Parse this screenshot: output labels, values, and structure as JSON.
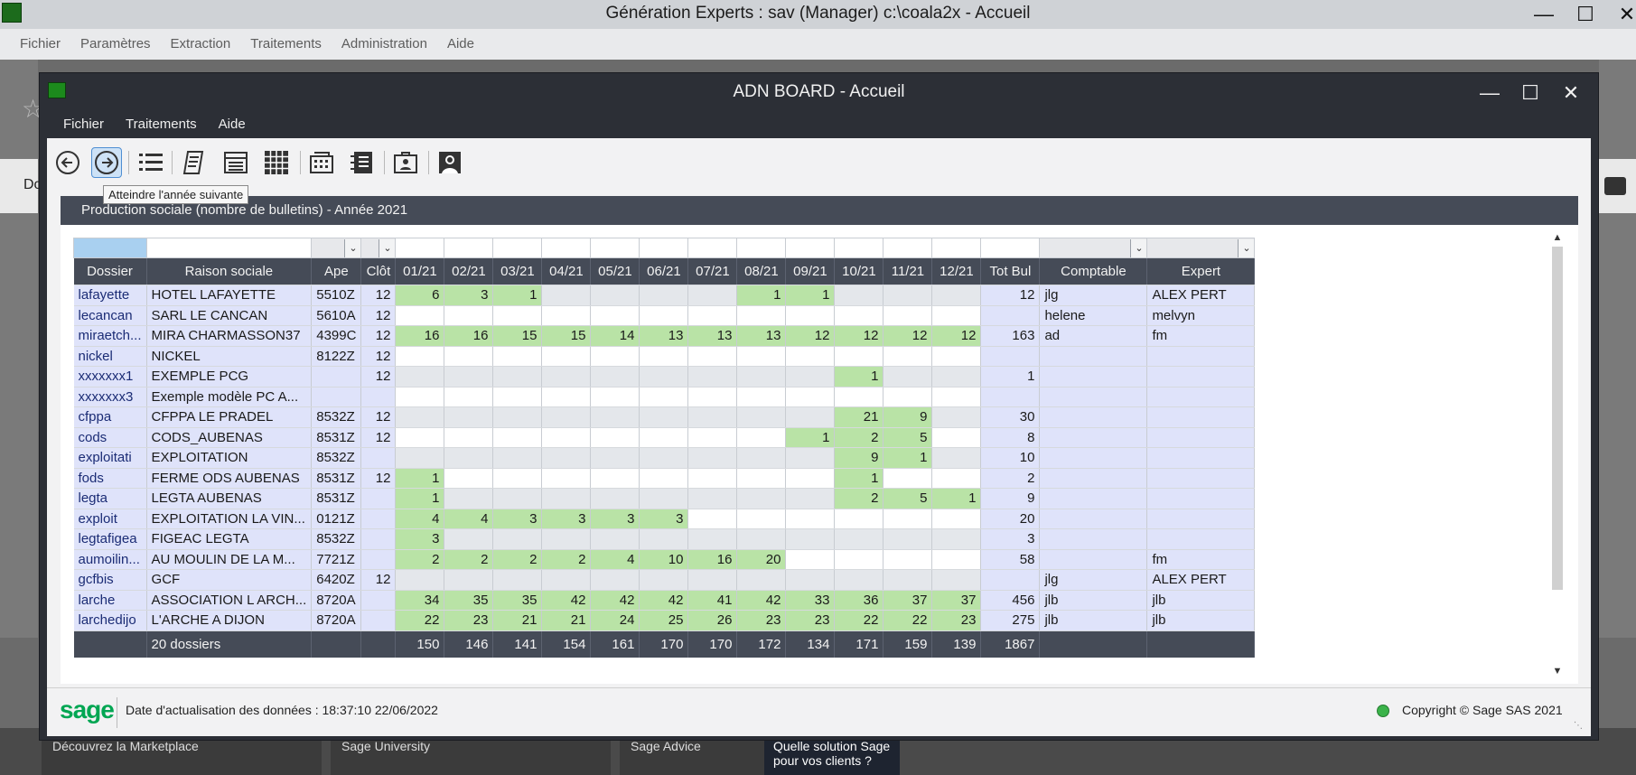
{
  "outer": {
    "title": "Génération Experts : sav (Manager) c:\\coala2x - Accueil",
    "menu": [
      "Fichier",
      "Paramètres",
      "Extraction",
      "Traitements",
      "Administration",
      "Aide"
    ],
    "left_tab_text": "Do",
    "bottom_tiles": [
      "Découvrez la Marketplace",
      "Sage University",
      "Sage Advice",
      "Quelle solution Sage pour vos clients ?"
    ]
  },
  "inner": {
    "title": "ADN BOARD - Accueil",
    "menu": [
      "Fichier",
      "Traitements",
      "Aide"
    ],
    "tooltip": "Atteindre l'année suivante",
    "panel_title": "Production sociale (nombre de bulletins) - Année 2021",
    "status_date": "Date d'actualisation des données : 18:37:10 22/06/2022",
    "copyright": "Copyright © Sage SAS 2021",
    "logo": "sage"
  },
  "columns": [
    "Dossier",
    "Raison sociale",
    "Ape",
    "Clôt",
    "01/21",
    "02/21",
    "03/21",
    "04/21",
    "05/21",
    "06/21",
    "07/21",
    "08/21",
    "09/21",
    "10/21",
    "11/21",
    "12/21",
    "Tot Bul",
    "Comptable",
    "Expert"
  ],
  "rows": [
    {
      "dossier": "lafayette",
      "raison": "HOTEL LAFAYETTE",
      "ape": "5510Z",
      "clot": "12",
      "m": [
        "6",
        "3",
        "1",
        "",
        "",
        "",
        "",
        "1",
        "1",
        "",
        "",
        ""
      ],
      "tot": "12",
      "comptable": "jlg",
      "expert": "ALEX PERT"
    },
    {
      "dossier": "lecancan",
      "raison": "SARL LE CANCAN",
      "ape": "5610A",
      "clot": "12",
      "m": [
        "",
        "",
        "",
        "",
        "",
        "",
        "",
        "",
        "",
        "",
        "",
        ""
      ],
      "tot": "",
      "comptable": "helene",
      "expert": "melvyn"
    },
    {
      "dossier": "miraetch...",
      "raison": "MIRA  CHARMASSON37",
      "ape": "4399C",
      "clot": "12",
      "m": [
        "16",
        "16",
        "15",
        "15",
        "14",
        "13",
        "13",
        "13",
        "12",
        "12",
        "12",
        "12"
      ],
      "tot": "163",
      "comptable": "ad",
      "expert": "fm"
    },
    {
      "dossier": "nickel",
      "raison": "NICKEL",
      "ape": "8122Z",
      "clot": "12",
      "m": [
        "",
        "",
        "",
        "",
        "",
        "",
        "",
        "",
        "",
        "",
        "",
        ""
      ],
      "tot": "",
      "comptable": "",
      "expert": ""
    },
    {
      "dossier": "xxxxxxx1",
      "raison": "EXEMPLE PCG",
      "ape": "",
      "clot": "12",
      "m": [
        "",
        "",
        "",
        "",
        "",
        "",
        "",
        "",
        "",
        "1",
        "",
        ""
      ],
      "tot": "1",
      "comptable": "",
      "expert": ""
    },
    {
      "dossier": "xxxxxxx3",
      "raison": "Exemple modèle PC A...",
      "ape": "",
      "clot": "",
      "m": [
        "",
        "",
        "",
        "",
        "",
        "",
        "",
        "",
        "",
        "",
        "",
        ""
      ],
      "tot": "",
      "comptable": "",
      "expert": ""
    },
    {
      "dossier": "cfppa",
      "raison": "CFPPA LE PRADEL",
      "ape": "8532Z",
      "clot": "12",
      "m": [
        "",
        "",
        "",
        "",
        "",
        "",
        "",
        "",
        "",
        "21",
        "9",
        ""
      ],
      "tot": "30",
      "comptable": "",
      "expert": ""
    },
    {
      "dossier": "cods",
      "raison": "CODS_AUBENAS",
      "ape": "8531Z",
      "clot": "12",
      "m": [
        "",
        "",
        "",
        "",
        "",
        "",
        "",
        "",
        "1",
        "2",
        "5",
        ""
      ],
      "tot": "8",
      "comptable": "",
      "expert": ""
    },
    {
      "dossier": "exploitati",
      "raison": "EXPLOITATION",
      "ape": "8532Z",
      "clot": "",
      "m": [
        "",
        "",
        "",
        "",
        "",
        "",
        "",
        "",
        "",
        "9",
        "1",
        ""
      ],
      "tot": "10",
      "comptable": "",
      "expert": ""
    },
    {
      "dossier": "fods",
      "raison": "FERME ODS AUBENAS",
      "ape": "8531Z",
      "clot": "12",
      "m": [
        "1",
        "",
        "",
        "",
        "",
        "",
        "",
        "",
        "",
        "1",
        "",
        ""
      ],
      "tot": "2",
      "comptable": "",
      "expert": ""
    },
    {
      "dossier": "legta",
      "raison": "LEGTA AUBENAS",
      "ape": "8531Z",
      "clot": "",
      "m": [
        "1",
        "",
        "",
        "",
        "",
        "",
        "",
        "",
        "",
        "2",
        "5",
        "1"
      ],
      "tot": "9",
      "comptable": "",
      "expert": ""
    },
    {
      "dossier": "exploit",
      "raison": "EXPLOITATION LA VIN...",
      "ape": "0121Z",
      "clot": "",
      "m": [
        "4",
        "4",
        "3",
        "3",
        "3",
        "3",
        "",
        "",
        "",
        "",
        "",
        ""
      ],
      "tot": "20",
      "comptable": "",
      "expert": ""
    },
    {
      "dossier": "legtafigea",
      "raison": "FIGEAC LEGTA",
      "ape": "8532Z",
      "clot": "",
      "m": [
        "3",
        "",
        "",
        "",
        "",
        "",
        "",
        "",
        "",
        "",
        "",
        ""
      ],
      "tot": "3",
      "comptable": "",
      "expert": ""
    },
    {
      "dossier": "aumoilin...",
      "raison": "AU MOULIN DE LA M...",
      "ape": "7721Z",
      "clot": "",
      "m": [
        "2",
        "2",
        "2",
        "2",
        "4",
        "10",
        "16",
        "20",
        "",
        "",
        "",
        ""
      ],
      "tot": "58",
      "comptable": "",
      "expert": "fm"
    },
    {
      "dossier": "gcfbis",
      "raison": "GCF",
      "ape": "6420Z",
      "clot": "12",
      "m": [
        "",
        "",
        "",
        "",
        "",
        "",
        "",
        "",
        "",
        "",
        "",
        ""
      ],
      "tot": "",
      "comptable": "jlg",
      "expert": "ALEX PERT"
    },
    {
      "dossier": "larche",
      "raison": "ASSOCIATION L ARCH...",
      "ape": "8720A",
      "clot": "",
      "m": [
        "34",
        "35",
        "35",
        "42",
        "42",
        "42",
        "41",
        "42",
        "33",
        "36",
        "37",
        "37"
      ],
      "tot": "456",
      "comptable": "jlb",
      "expert": "jlb"
    },
    {
      "dossier": "larchedijo",
      "raison": "L'ARCHE A DIJON",
      "ape": "8720A",
      "clot": "",
      "m": [
        "22",
        "23",
        "21",
        "21",
        "24",
        "25",
        "26",
        "23",
        "23",
        "22",
        "22",
        "23"
      ],
      "tot": "275",
      "comptable": "jlb",
      "expert": "jlb"
    }
  ],
  "totals": {
    "label": "20 dossiers",
    "m": [
      "150",
      "146",
      "141",
      "154",
      "161",
      "170",
      "170",
      "172",
      "134",
      "171",
      "159",
      "139"
    ],
    "tot": "1867"
  }
}
